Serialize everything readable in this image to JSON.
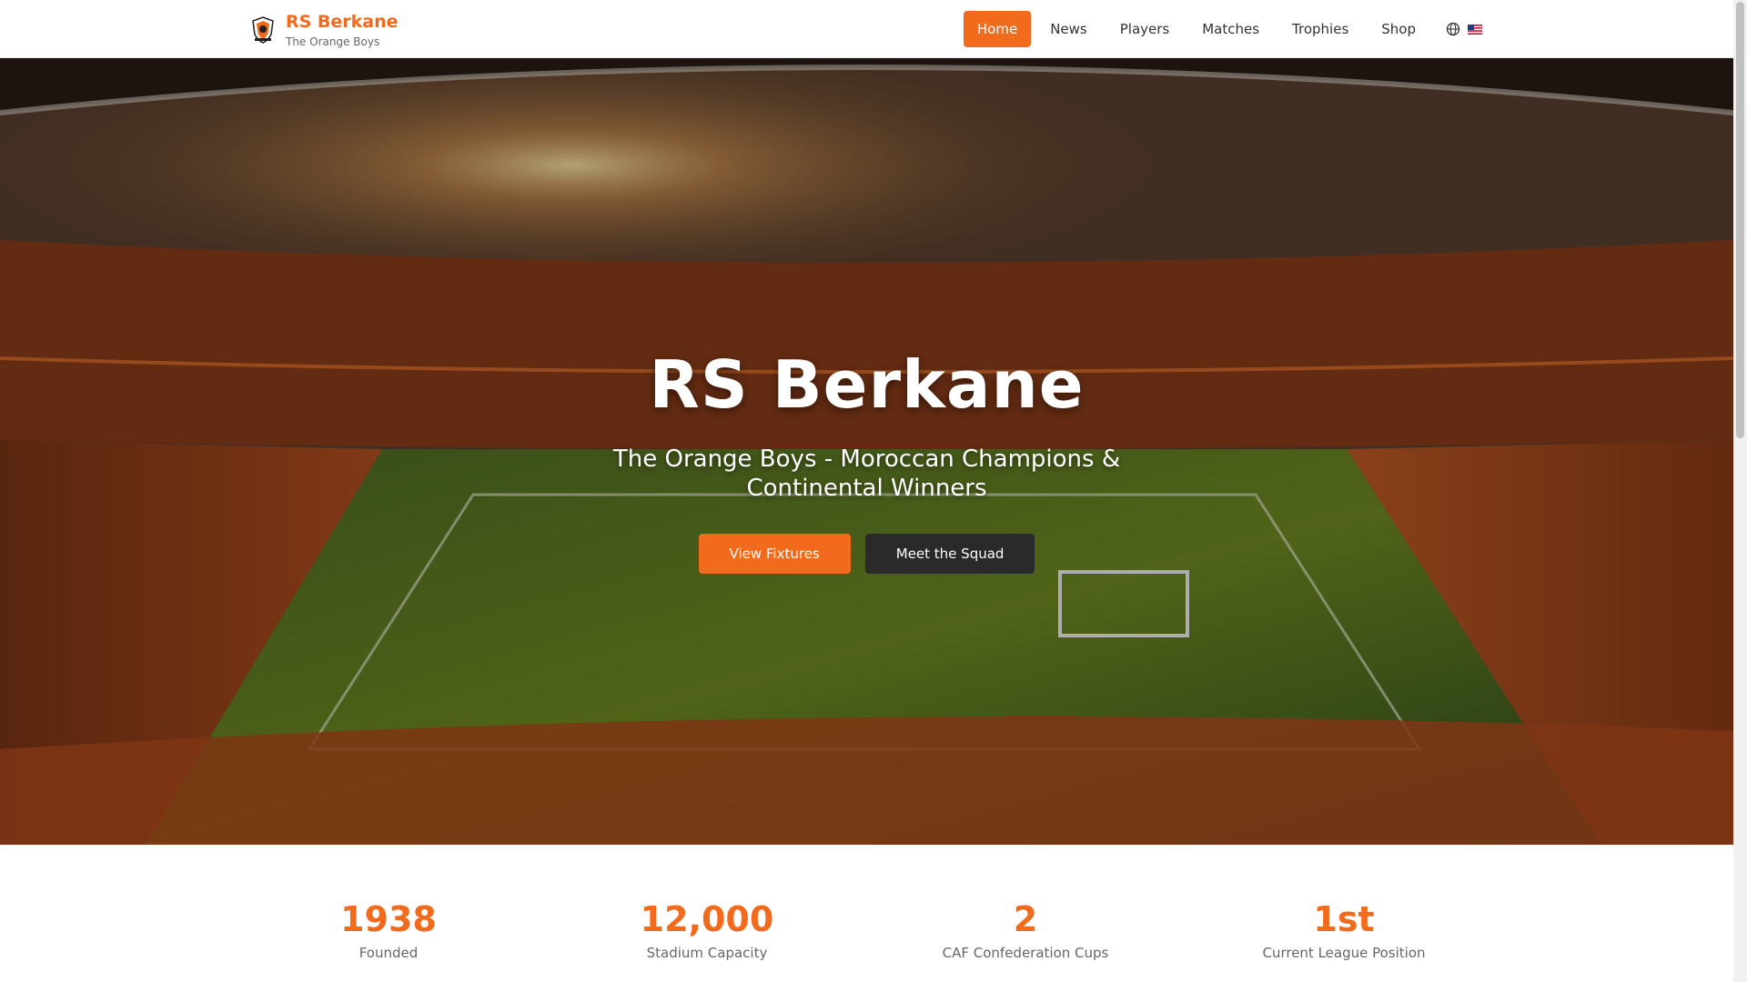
{
  "brand": {
    "name": "RS Berkane",
    "tagline": "The Orange Boys",
    "logo_icon": "club-crest-icon"
  },
  "nav": {
    "items": [
      {
        "label": "Home",
        "active": true
      },
      {
        "label": "News",
        "active": false
      },
      {
        "label": "Players",
        "active": false
      },
      {
        "label": "Matches",
        "active": false
      },
      {
        "label": "Trophies",
        "active": false
      },
      {
        "label": "Shop",
        "active": false
      }
    ],
    "language_icon": "globe-icon",
    "flag_icon": "us-flag-icon"
  },
  "hero": {
    "title": "RS Berkane",
    "subtitle": "The Orange Boys - Moroccan Champions & Continental Winners",
    "background": "stadium-photo",
    "primary_button": "View Fixtures",
    "secondary_button": "Meet the Squad"
  },
  "stats": [
    {
      "value": "1938",
      "label": "Founded"
    },
    {
      "value": "12,000",
      "label": "Stadium Capacity"
    },
    {
      "value": "2",
      "label": "CAF Confederation Cups"
    },
    {
      "value": "1st",
      "label": "Current League Position"
    }
  ],
  "colors": {
    "accent": "#f26a1b",
    "dark_button": "#2a2a2a",
    "muted_text": "#666666"
  }
}
